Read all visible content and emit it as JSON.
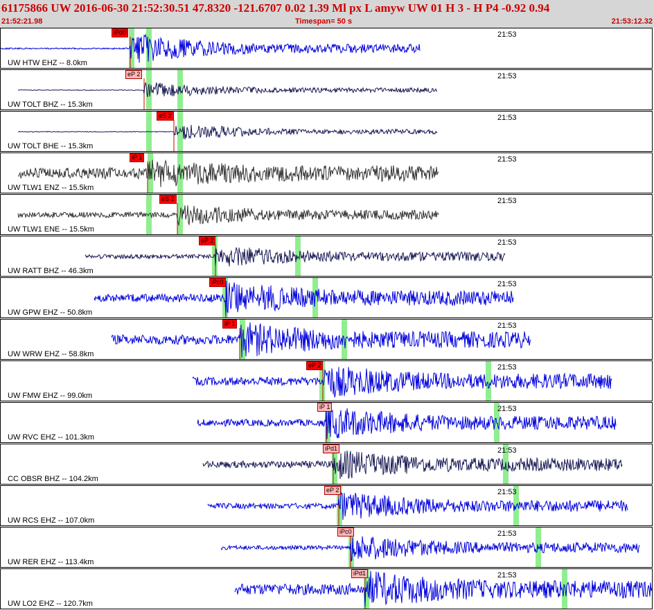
{
  "header": {
    "line": "61175866 UW 2016-06-30 21:52:30.51   47.8320 -121.6707   0.02  1.39 Ml  px  L amyw      UW 01  H   3  -  H P4   -0.92  0.94",
    "start_time": "21:52:21.98",
    "timespan": "Timespan=  50 s",
    "end_time": "21:53:12.32"
  },
  "colors": {
    "header_bg": "#d6d6d6",
    "header_text": "#cc0000",
    "wave_blue": "#0000dd",
    "wave_dark": "#1a1a55",
    "wave_gray": "#333333",
    "pick_red": "#ff0000",
    "pick_pale": "#ffb6b6",
    "green_band": "#90ee90"
  },
  "traces": [
    {
      "label": "UW HTW EHZ -- 8.0km",
      "time_label": "21:53",
      "wave_color": "#0000dd",
      "picks": [
        {
          "text": "iPd0",
          "style": "solid"
        }
      ]
    },
    {
      "label": "UW TOLT BHZ -- 15.3km",
      "time_label": "21:53",
      "wave_color": "#1a1a55",
      "picks": [
        {
          "text": "eP 2",
          "style": "pale"
        }
      ]
    },
    {
      "label": "UW TOLT BHE -- 15.3km",
      "time_label": "21:53",
      "wave_color": "#1a1a55",
      "picks": [
        {
          "text": "eS 2",
          "style": "solid"
        }
      ]
    },
    {
      "label": "UW TLW1 ENZ -- 15.5km",
      "time_label": "21:53",
      "wave_color": "#333333",
      "picks": [
        {
          "text": "iP 1",
          "style": "solid"
        }
      ]
    },
    {
      "label": "UW TLW1 ENE -- 15.5km",
      "time_label": "21:53",
      "wave_color": "#333333",
      "picks": [
        {
          "text": "eS 2",
          "style": "solid"
        }
      ]
    },
    {
      "label": "UW RATT BHZ -- 46.3km",
      "time_label": "21:53",
      "wave_color": "#1a1a55",
      "picks": [
        {
          "text": "eP 2",
          "style": "solid"
        }
      ]
    },
    {
      "label": "UW GPW EHZ -- 50.8km",
      "time_label": "21:53",
      "wave_color": "#0000dd",
      "picks": [
        {
          "text": "iPc0",
          "style": "solid"
        }
      ]
    },
    {
      "label": "UW WRW EHZ -- 58.8km",
      "time_label": "21:53",
      "wave_color": "#0000dd",
      "picks": [
        {
          "text": "iP 1",
          "style": "solid"
        }
      ]
    },
    {
      "label": "UW FMW EHZ -- 99.0km",
      "time_label": "21:53",
      "wave_color": "#0000dd",
      "picks": [
        {
          "text": "eP 2",
          "style": "solid"
        }
      ]
    },
    {
      "label": "UW RVC EHZ -- 101.3km",
      "time_label": "21:53",
      "wave_color": "#0000dd",
      "picks": [
        {
          "text": "iP 1",
          "style": "pale"
        }
      ]
    },
    {
      "label": "CC OBSR BHZ -- 104.2km",
      "time_label": "21:53",
      "wave_color": "#1a1a55",
      "picks": [
        {
          "text": "iPd1",
          "style": "pale"
        }
      ]
    },
    {
      "label": "UW RCS EHZ -- 107.0km",
      "time_label": "21:53",
      "wave_color": "#0000dd",
      "picks": [
        {
          "text": "eP 2",
          "style": "pale"
        }
      ]
    },
    {
      "label": "UW RER EHZ -- 113.4km",
      "time_label": "21:53",
      "wave_color": "#0000dd",
      "picks": [
        {
          "text": "iPc0",
          "style": "pale"
        }
      ]
    },
    {
      "label": "UW LO2 EHZ -- 120.7km",
      "time_label": "21:53",
      "wave_color": "#0000dd",
      "picks": [
        {
          "text": "iPd1",
          "style": "pale"
        }
      ]
    }
  ]
}
